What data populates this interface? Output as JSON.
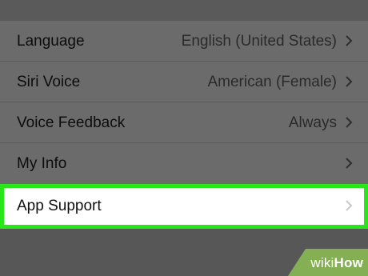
{
  "settings": {
    "rows": [
      {
        "label": "Language",
        "value": "English (United States)",
        "icon": "chevron-right-icon"
      },
      {
        "label": "Siri Voice",
        "value": "American (Female)",
        "icon": "chevron-right-icon"
      },
      {
        "label": "Voice Feedback",
        "value": "Always",
        "icon": "chevron-right-icon"
      },
      {
        "label": "My Info",
        "value": "",
        "icon": "chevron-right-icon"
      }
    ],
    "highlighted_row": {
      "label": "App Support",
      "icon": "chevron-right-icon"
    }
  },
  "watermark": {
    "wiki": "wiki",
    "how": "How"
  },
  "colors": {
    "background": "#575757",
    "list_background": "#6b6b6b",
    "highlight_border": "#29e619",
    "highlight_background": "#ffffff",
    "watermark_green": "#8cbf52"
  }
}
